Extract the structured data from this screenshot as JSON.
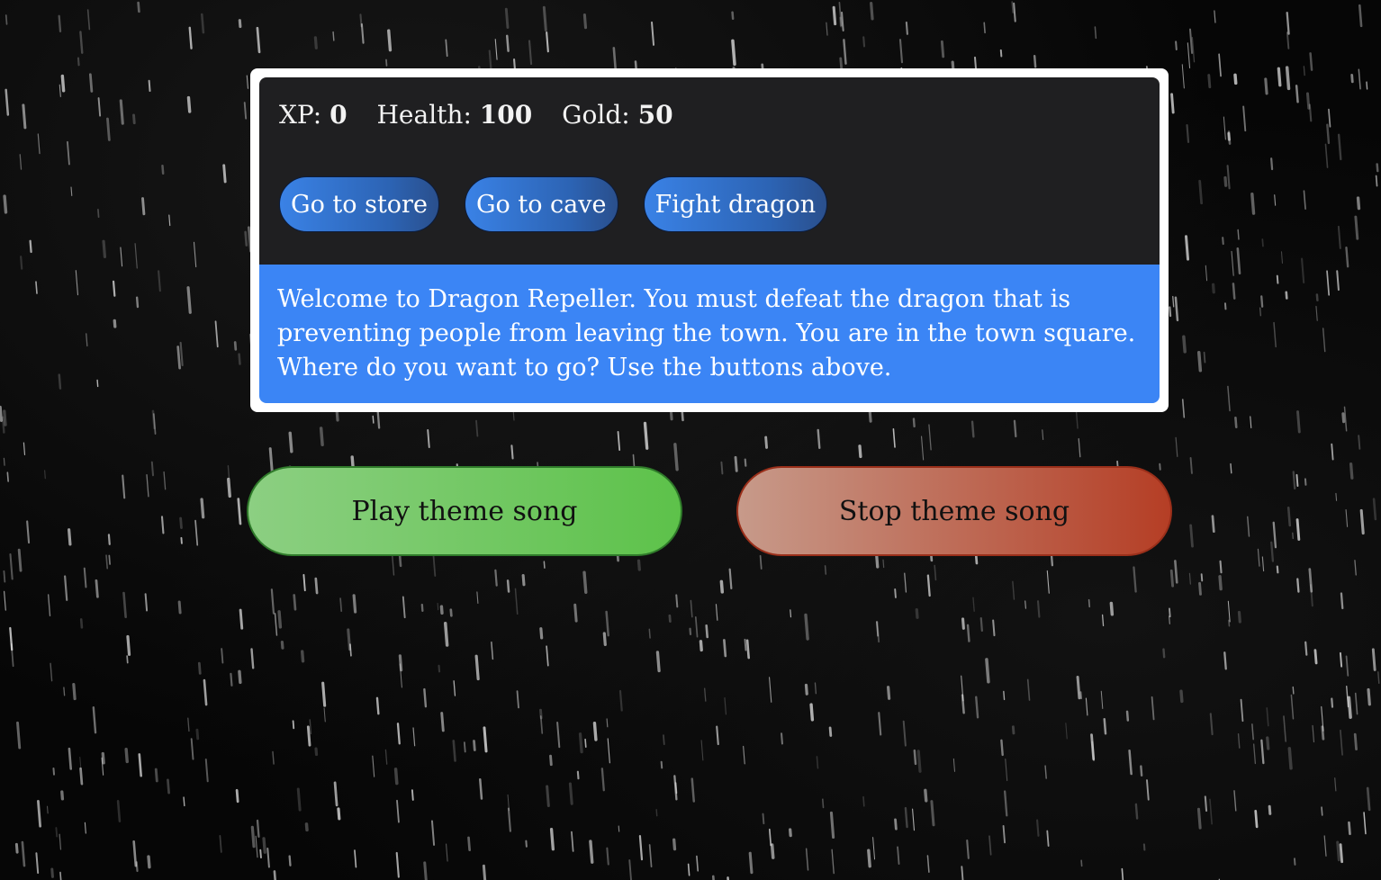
{
  "stats": {
    "xp_label": "XP:",
    "xp_value": "0",
    "health_label": "Health:",
    "health_value": "100",
    "gold_label": "Gold:",
    "gold_value": "50"
  },
  "actions": {
    "button1": "Go to store",
    "button2": "Go to cave",
    "button3": "Fight dragon"
  },
  "game_text": "Welcome to Dragon Repeller. You must defeat the dragon that is preventing people from leaving the town. You are in the town square. Where do you want to go? Use the buttons above.",
  "music": {
    "play_label": "Play theme song",
    "stop_label": "Stop theme song"
  },
  "colors": {
    "background": "#050505",
    "panel_dark": "#1f1f21",
    "text_panel": "#3b85f5",
    "action_button": "#2c63b3",
    "play_button": "#5dc24a",
    "stop_button": "#b53e25"
  },
  "background_image": "rain-streaks-on-black"
}
